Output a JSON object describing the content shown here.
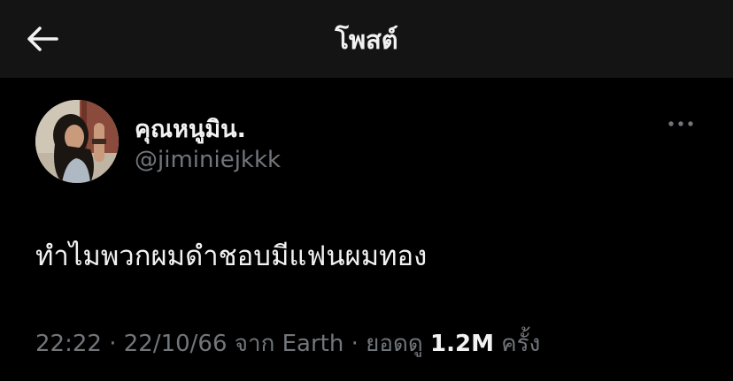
{
  "header": {
    "title": "โพสต์",
    "back_icon": "arrow-left-icon"
  },
  "post": {
    "author": {
      "display_name": "คุณหนูมิน.",
      "handle": "@jiminiejkkk"
    },
    "more_icon": "more-horizontal-icon",
    "text": "ทำไมพวกผมดำชอบมีแฟนผมทอง",
    "meta": {
      "time": "22:22",
      "separator1": " · ",
      "date": "22/10/66",
      "source_prefix": " จาก ",
      "source": "Earth",
      "separator2": " · ",
      "views_label": "ยอดดู ",
      "views_count": "1.2M",
      "views_suffix": " ครั้ง"
    }
  },
  "colors": {
    "background": "#000000",
    "header_background": "#141414",
    "primary_text": "#f2f2f2",
    "secondary_text": "#71767b"
  }
}
